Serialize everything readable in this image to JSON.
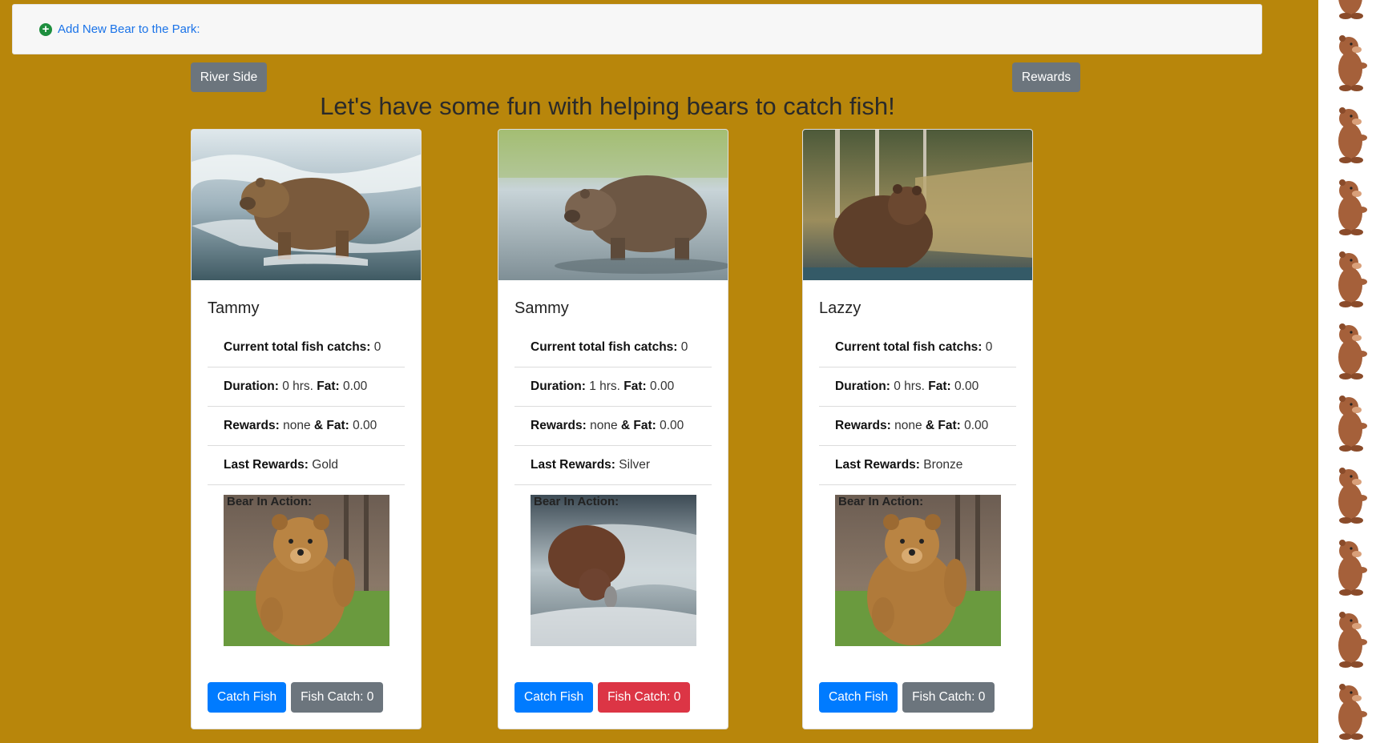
{
  "topbar": {
    "add_label": "Add New Bear to the Park:",
    "add_icon": "plus-circle-icon"
  },
  "nav": {
    "river_label": "River Side",
    "rewards_label": "Rewards"
  },
  "headline": "Let's have some fun with helping bears to catch fish!",
  "labels": {
    "total": "Current total fish catchs:",
    "duration": "Duration:",
    "hrs": "hrs.",
    "fat": "Fat:",
    "rewards": "Rewards:",
    "and_fat": "& Fat:",
    "last_rewards": "Last Rewards:",
    "action": "Bear In Action:",
    "catch_btn": "Catch Fish"
  },
  "bears": [
    {
      "name": "Tammy",
      "total": "0",
      "duration": "0",
      "fat": "0.00",
      "rewards": "none",
      "reward_fat": "0.00",
      "last_rewards": "Gold",
      "fish_catch": "Fish Catch: 0",
      "fish_catch_color": "#6c757d"
    },
    {
      "name": "Sammy",
      "total": "0",
      "duration": "1",
      "fat": "0.00",
      "rewards": "none",
      "reward_fat": "0.00",
      "last_rewards": "Silver",
      "fish_catch": "Fish Catch: 0",
      "fish_catch_color": "#dc3545"
    },
    {
      "name": "Lazzy",
      "total": "0",
      "duration": "0",
      "fat": "0.00",
      "rewards": "none",
      "reward_fat": "0.00",
      "last_rewards": "Bronze",
      "fish_catch": "Fish Catch: 0",
      "fish_catch_color": "#6c757d"
    }
  ],
  "colors": {
    "page_bg": "#b8860b",
    "primary": "#007bff",
    "secondary": "#6c757d",
    "danger": "#dc3545"
  }
}
